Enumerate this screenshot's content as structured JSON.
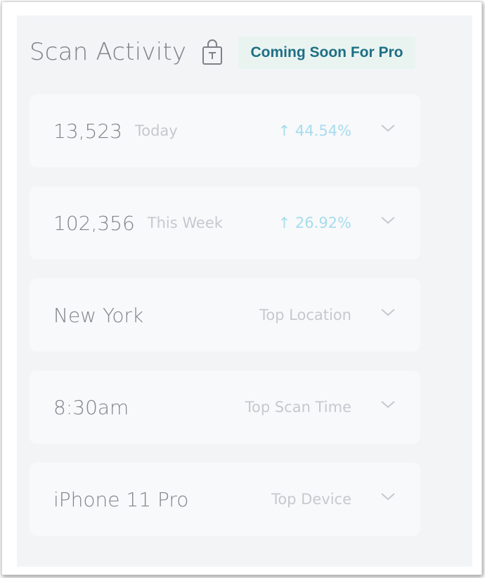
{
  "header": {
    "title": "Scan Activity",
    "lock_icon": "lock-icon",
    "badge": "Coming Soon For Pro"
  },
  "rows": [
    {
      "value": "13,523",
      "label": "Today",
      "delta": "↑ 44.54%",
      "icon": "chevron-down-icon"
    },
    {
      "value": "102,356",
      "label": "This Week",
      "delta": "↑ 26.92%",
      "icon": "chevron-down-icon"
    },
    {
      "value": "New York",
      "label": "Top Location",
      "icon": "chevron-down-icon"
    },
    {
      "value": "8:30am",
      "label": "Top Scan Time",
      "icon": "chevron-down-icon"
    },
    {
      "value": "iPhone 11 Pro",
      "label": "Top Device",
      "icon": "chevron-down-icon"
    }
  ],
  "colors": {
    "panel_bg": "#f2f4f6",
    "card_bg": "#f8f9fa",
    "badge_bg": "#e9f4f1",
    "badge_text": "#1e6f85",
    "delta_text": "#a7dcee"
  }
}
